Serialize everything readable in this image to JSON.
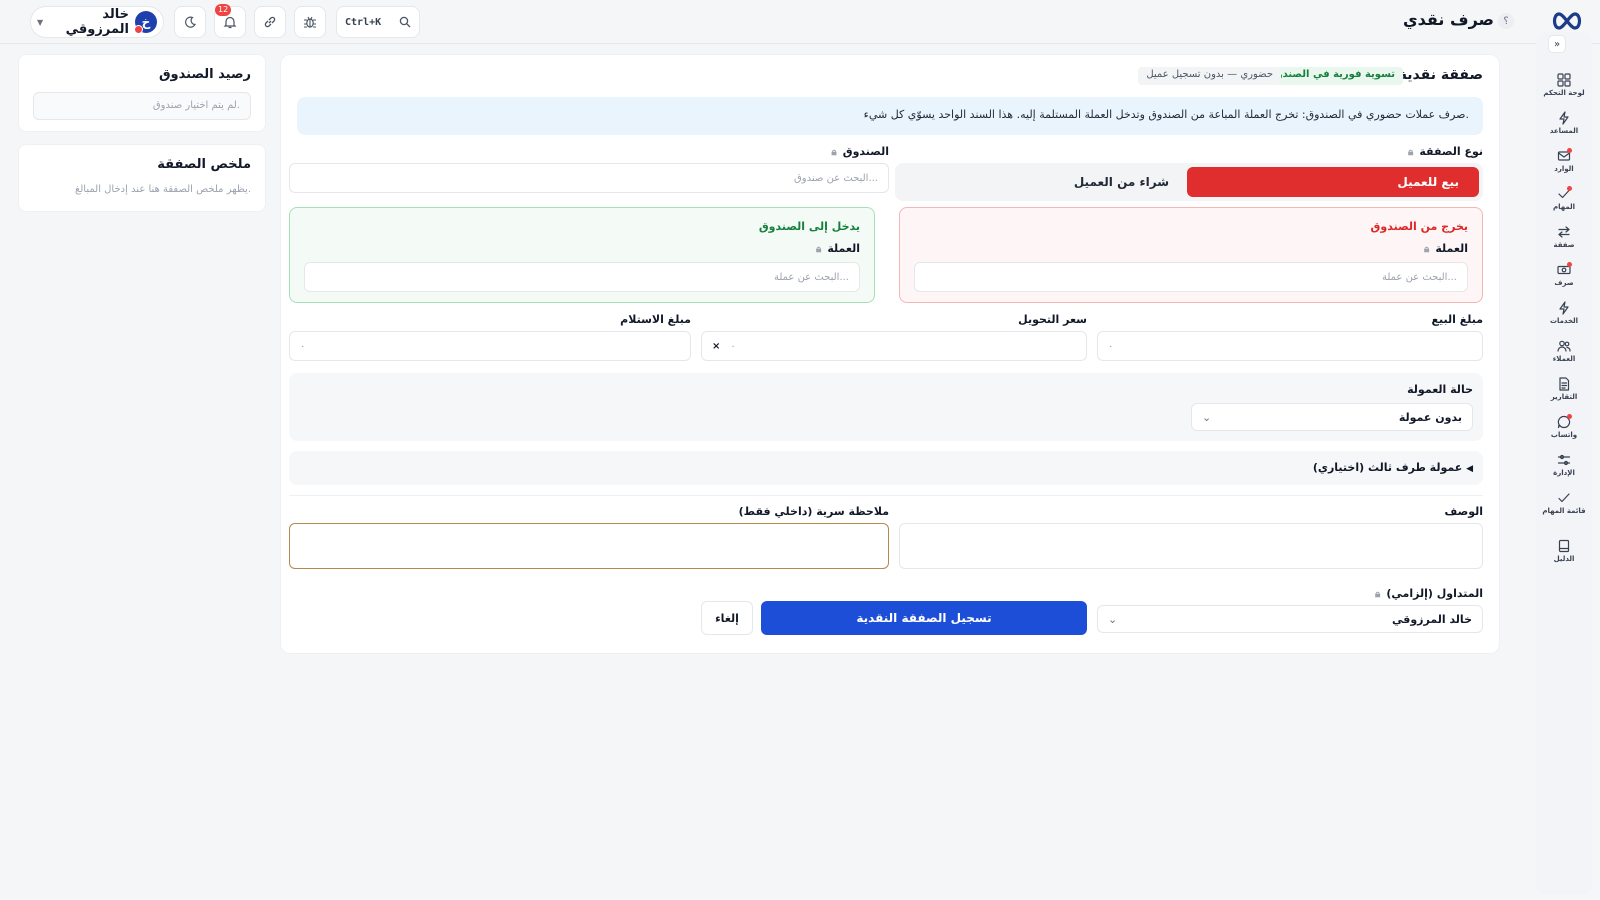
{
  "app": {
    "title": "صرف نقدي",
    "help": "؟",
    "search_shortcut": "Ctrl+K",
    "notifications_count": "12",
    "user": {
      "name": "خالد المرزوقي",
      "initial": "خ"
    }
  },
  "sidebar": {
    "items": [
      {
        "label": "لوحة التحكم",
        "icon": "dashboard-icon",
        "dot": false
      },
      {
        "label": "المساعد",
        "icon": "bolt-icon",
        "dot": false
      },
      {
        "label": "الوارد",
        "icon": "inbox-icon",
        "dot": true
      },
      {
        "label": "المهام",
        "icon": "check-icon",
        "dot": true
      },
      {
        "label": "صفقة",
        "icon": "swap-icon",
        "dot": false
      },
      {
        "label": "صرف",
        "icon": "cash-icon",
        "dot": true
      },
      {
        "label": "الخدمات",
        "icon": "bolt-icon",
        "dot": false
      },
      {
        "label": "العملاء",
        "icon": "users-icon",
        "dot": false
      },
      {
        "label": "التقارير",
        "icon": "report-icon",
        "dot": false
      },
      {
        "label": "واتساب",
        "icon": "chat-icon",
        "dot": true
      },
      {
        "label": "الإدارة",
        "icon": "sliders-icon",
        "dot": false
      },
      {
        "label": "قائمة المهام",
        "icon": "checklist-icon",
        "dot": false
      },
      {
        "label": "الدليل",
        "icon": "book-icon",
        "dot": false
      }
    ]
  },
  "left": {
    "balance": {
      "title": "رصيد الصندوق",
      "placeholder": "لم يتم اختيار صندوق."
    },
    "summary": {
      "title": "ملخص الصفقة",
      "note": "يظهر ملخص الصفقة هنا عند إدخال المبالغ."
    }
  },
  "form": {
    "title": "صفقة نقدية",
    "badge_green": "تسوية فورية في الصندوق",
    "badge_gray": "حضوري — بدون تسجيل عميل",
    "info": "صرف عملات حضوري في الصندوق: تخرج العملة المباعة من الصندوق وتدخل العملة المستلمة إليه. هذا السند الواحد يسوّي كل شيء.",
    "deal_type": {
      "label": "نوع الصفقة",
      "sell": "بيع للعميل",
      "buy": "شراء من العميل"
    },
    "fund": {
      "label": "الصندوق",
      "placeholder": "البحث عن صندوق..."
    },
    "out_box": {
      "title": "يخرج من الصندوق",
      "currency_label": "العملة",
      "placeholder": "البحث عن عملة..."
    },
    "in_box": {
      "title": "يدخل إلى الصندوق",
      "currency_label": "العملة",
      "placeholder": "البحث عن عملة..."
    },
    "sale_amount": {
      "label": "مبلغ البيع",
      "value": "٠"
    },
    "rate": {
      "label": "سعر التحويل",
      "value": "٠",
      "op": "×"
    },
    "receive_amount": {
      "label": "مبلغ الاستلام",
      "value": "٠"
    },
    "commission": {
      "label": "حالة العمولة",
      "value": "بدون عمولة"
    },
    "third_party": "عمولة طرف ثالث (اختياري)",
    "description_label": "الوصف",
    "private_note_label": "ملاحظة سرية (داخلي فقط)",
    "dealer": {
      "label": "المتداول (إلزامي)",
      "value": "خالد المرزوقي"
    },
    "submit": "تسجيل الصفقة النقدية",
    "cancel": "إلغاء"
  },
  "colors": {
    "primary": "#1d4ed8",
    "sell": "#e02e2e",
    "out": "#dc2626",
    "in": "#15803d"
  }
}
